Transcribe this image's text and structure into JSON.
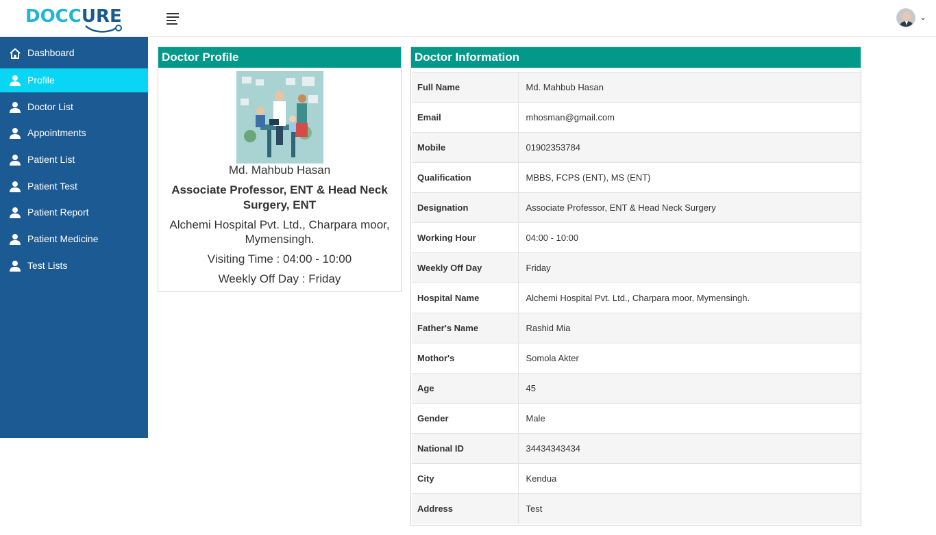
{
  "brand": {
    "logo_text_a": "DOCC",
    "logo_text_b": "URE"
  },
  "header": {
    "menu_icon": "hamburger-icon",
    "avatar_icon": "user-avatar",
    "dropdown_icon": "chevron-down-icon"
  },
  "sidebar": {
    "items": [
      {
        "label": "Dashboard",
        "icon": "home-icon",
        "active": false
      },
      {
        "label": "Profile",
        "icon": "user-icon",
        "active": true
      },
      {
        "label": "Doctor List",
        "icon": "user-icon",
        "active": false
      },
      {
        "label": "Appointments",
        "icon": "user-icon",
        "active": false
      },
      {
        "label": "Patient List",
        "icon": "user-icon",
        "active": false
      },
      {
        "label": "Patient Test",
        "icon": "user-icon",
        "active": false
      },
      {
        "label": "Patient Report",
        "icon": "user-icon",
        "active": false
      },
      {
        "label": "Patient Medicine",
        "icon": "user-icon",
        "active": false
      },
      {
        "label": "Test Lists",
        "icon": "user-icon",
        "active": false
      }
    ]
  },
  "profile": {
    "title": "Doctor Profile",
    "name": "Md. Mahbub Hasan",
    "designation": "Associate Professor, ENT & Head Neck Surgery, ENT",
    "hospital": "Alchemi Hospital Pvt. Ltd., Charpara moor, Mymensingh.",
    "visiting_time": "Visiting Time : 04:00 - 10:00",
    "weekly_off": "Weekly Off Day : Friday"
  },
  "info": {
    "title": "Doctor Information",
    "rows": [
      {
        "label": "Full Name",
        "value": "Md. Mahbub Hasan"
      },
      {
        "label": "Email",
        "value": "mhosman@gmail.com"
      },
      {
        "label": "Mobile",
        "value": "01902353784"
      },
      {
        "label": "Qualification",
        "value": "MBBS, FCPS (ENT), MS (ENT)"
      },
      {
        "label": "Designation",
        "value": "Associate Professor, ENT & Head Neck Surgery"
      },
      {
        "label": "Working Hour",
        "value": "04:00 - 10:00"
      },
      {
        "label": "Weekly Off Day",
        "value": "Friday"
      },
      {
        "label": "Hospital Name",
        "value": "Alchemi Hospital Pvt. Ltd., Charpara moor, Mymensingh."
      },
      {
        "label": "Father's Name",
        "value": "Rashid Mia"
      },
      {
        "label": "Mothor's",
        "value": "Somola Akter"
      },
      {
        "label": "Age",
        "value": "45"
      },
      {
        "label": "Gender",
        "value": "Male"
      },
      {
        "label": "National ID",
        "value": "34434343434"
      },
      {
        "label": "City",
        "value": "Kendua"
      },
      {
        "label": "Address",
        "value": "Test"
      }
    ]
  },
  "colors": {
    "sidebar_bg": "#1c5a94",
    "active_item": "#09d6f4",
    "card_header": "#02998a",
    "brand_light": "#1fb5d6",
    "brand_dark": "#1b5a8e"
  }
}
